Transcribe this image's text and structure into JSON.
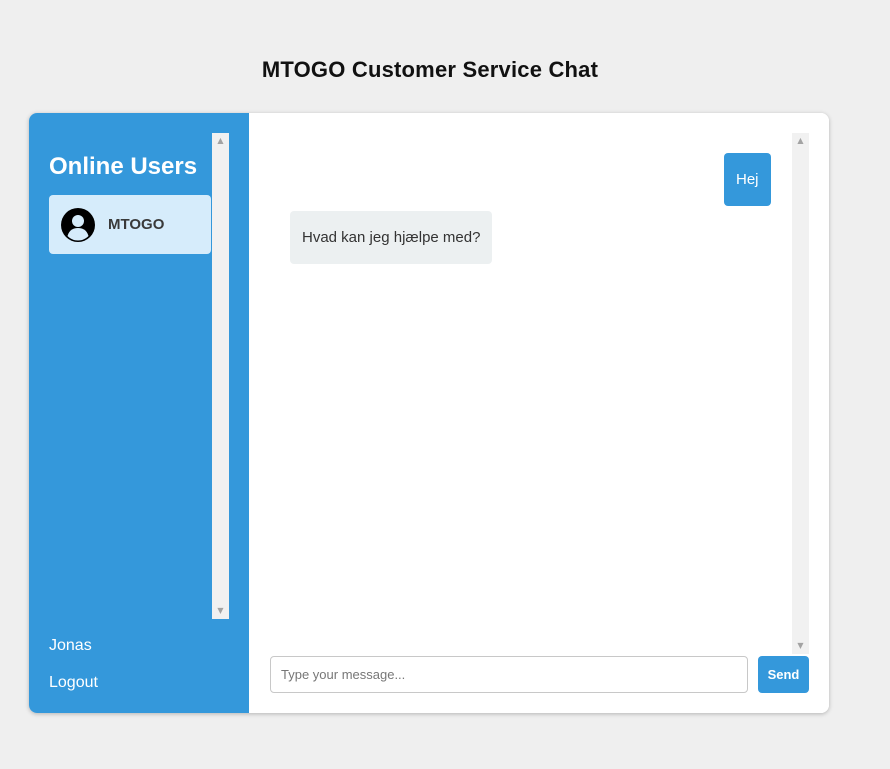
{
  "page": {
    "title": "MTOGO Customer Service Chat"
  },
  "sidebar": {
    "heading": "Online Users",
    "users": [
      {
        "name": "MTOGO",
        "icon": "user-avatar-icon",
        "selected": true
      }
    ],
    "current_user": "Jonas",
    "logout_label": "Logout"
  },
  "chat": {
    "messages": [
      {
        "direction": "sent",
        "text": "Hej"
      },
      {
        "direction": "received",
        "text": "Hvad kan jeg hjælpe med?"
      }
    ],
    "input": {
      "value": "",
      "placeholder": "Type your message..."
    },
    "send_label": "Send"
  },
  "colors": {
    "background": "#efefef",
    "accent": "#3498db",
    "selected_user": "#d6ecfb",
    "received_bubble": "#ecf0f1",
    "scrollbar_track": "#f1f1f1"
  },
  "icons": {
    "scroll_up": "scroll-up-arrow-icon",
    "scroll_down": "scroll-down-arrow-icon",
    "avatar": "user-avatar-icon"
  }
}
